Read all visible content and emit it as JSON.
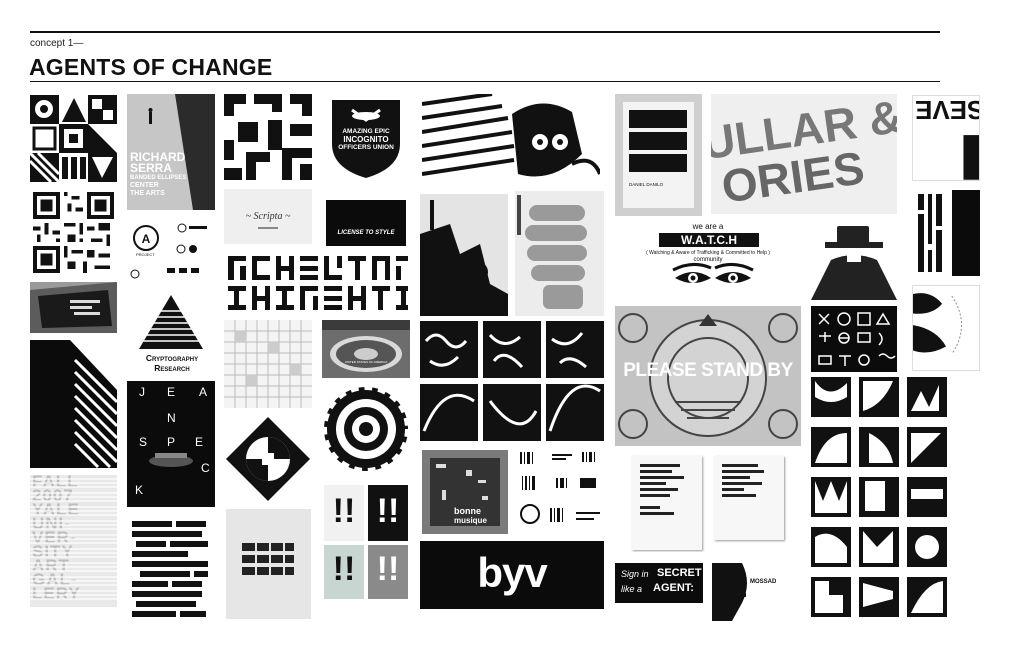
{
  "header": {
    "subtitle": "concept 1—",
    "title": "AGENTS OF CHANGE"
  },
  "tiles": {
    "richard_serra": [
      "RICHARD",
      "SERRA",
      "BANDED ELLIPSES",
      "CENTER",
      "THE ARTS"
    ],
    "officers_union": [
      "AMAZING EPIC",
      "INCOGNITO",
      "OFFICERS UNION"
    ],
    "license_to_style": "LICENSE TO STYLE",
    "project_label": "PROJECT",
    "cryptography_research": "Cryptography Research",
    "jean_spec": [
      "J",
      "E",
      "A",
      "N",
      "S",
      "P",
      "E",
      "C",
      "K"
    ],
    "fall_yale": [
      "FALL",
      "2007",
      "YALE",
      "UNI-",
      "VER-",
      "SITY",
      "ART",
      "GAL-",
      "LERY"
    ],
    "watch": {
      "line1": "we are a",
      "acronym": "W.A.T.C.H",
      "line2": "( Watching & Aware of Trafficking & Committed to Help )",
      "line3": "community"
    },
    "please_stand_by": "PLEASE STAND BY",
    "sevens_text": "ULLAR &",
    "stories_text": "ORIES",
    "seven": "SEVE",
    "byv": "byv",
    "bonne_musique": [
      "bonne",
      "musique"
    ],
    "daniel_danilo": "DANIEL DANILO",
    "secret_agent": [
      "Sign in",
      "SECRET",
      "like a",
      "AGENT:"
    ],
    "mossad": "MOSSAD",
    "seal_text": "UNITED STATES OF AMERICA",
    "exclamations": [
      "!!",
      "!!",
      "!!",
      "!!"
    ]
  }
}
